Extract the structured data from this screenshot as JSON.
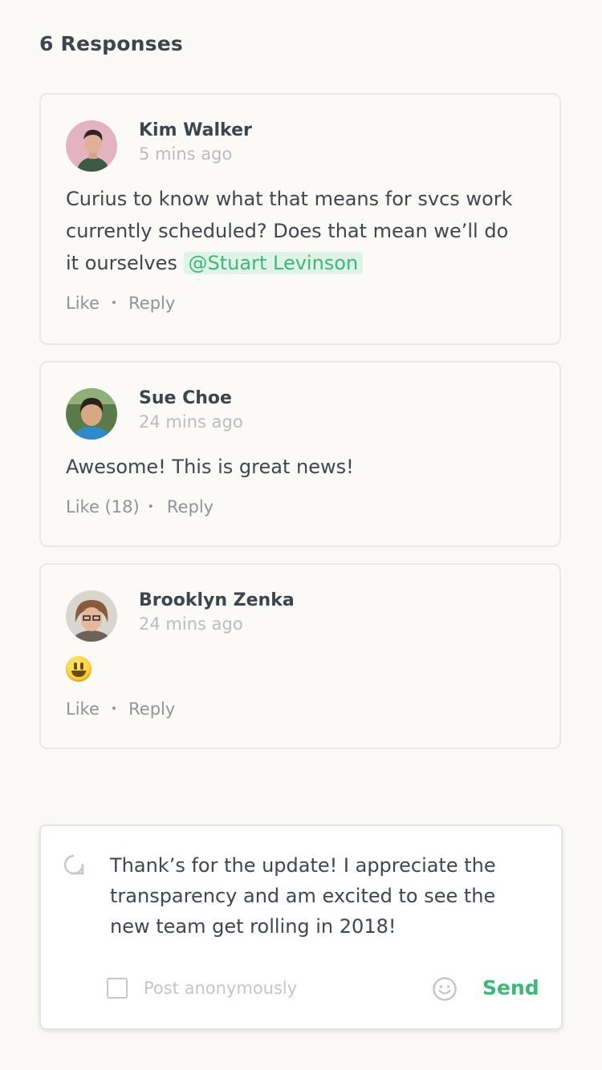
{
  "header": {
    "title": "6 Responses"
  },
  "comments": [
    {
      "author": "Kim Walker",
      "time": "5 mins ago",
      "body_lines": [
        "Curius to know what that means for svcs work",
        "currently scheduled? Does that mean we’ll do",
        "it ourselves"
      ],
      "mention": "@Stuart Levinson",
      "like_label": "Like",
      "reply_label": "Reply"
    },
    {
      "author": "Sue Choe",
      "time": "24 mins ago",
      "body": "Awesome! This is great news!",
      "like_label": "Like (18)",
      "reply_label": "Reply"
    },
    {
      "author": "Brooklyn Zenka",
      "time": "24 mins ago",
      "body_emoji": "smiley-emoji",
      "like_label": "Like",
      "reply_label": "Reply"
    }
  ],
  "composer": {
    "lines": [
      "Thank’s for the update! I appreciate the",
      "transparency and am excited to see the",
      "new team get rolling in 2018!"
    ],
    "anonymous_label": "Post anonymously",
    "send_label": "Send"
  },
  "colors": {
    "accent": "#3cb878",
    "mention_bg": "#dff4e7"
  }
}
